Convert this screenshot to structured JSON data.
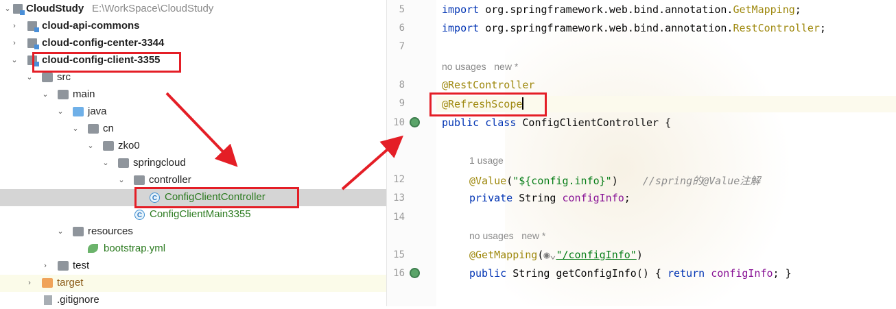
{
  "project": {
    "root_name": "CloudStudy",
    "root_path": "E:\\WorkSpace\\CloudStudy",
    "modules": [
      "cloud-api-commons",
      "cloud-config-center-3344",
      "cloud-config-client-3355"
    ],
    "tree": {
      "src": "src",
      "main": "main",
      "java": "java",
      "cn": "cn",
      "zko0": "zko0",
      "springcloud": "springcloud",
      "controller": "controller",
      "controller_class": "ConfigClientController",
      "main_class": "ConfigClientMain3355",
      "resources": "resources",
      "bootstrap": "bootstrap.yml",
      "test": "test",
      "target": "target",
      "gitignore": ".gitignore"
    }
  },
  "editor": {
    "line_numbers": [
      "5",
      "6",
      "7",
      "8",
      "9",
      "10",
      "12",
      "13",
      "14",
      "15",
      "16"
    ],
    "import1_kw": "import",
    "import1_pkg": " org.springframework.web.bind.annotation.",
    "import1_cls": "GetMapping",
    "import2_kw": "import",
    "import2_pkg": " org.springframework.web.bind.annotation.",
    "import2_cls": "RestController",
    "hint_no_usages_1": "no usages   new *",
    "ann_rest": "@RestController",
    "ann_refresh": "@RefreshScope",
    "class_kw": "public class",
    "class_name": " ConfigClientController {",
    "hint_1_usage": "1 usage",
    "value_ann": "@Value",
    "value_str": "\"${config.info}\"",
    "value_comment": "//spring的@Value注解",
    "field_kw": "private",
    "field_type": " String ",
    "field_name": "configInfo",
    "hint_no_usages_2": "no usages   new *",
    "getmapping_ann": "@GetMapping",
    "getmapping_str": "\"/configInfo\"",
    "method_kw": "public",
    "method_sig": " String getConfigInfo() { ",
    "return_kw": "return",
    "return_field": "configInfo",
    "method_end": "; }"
  },
  "colors": {
    "highlight_red": "#e41e26",
    "keyword": "#0033b3",
    "annotation": "#9e880d",
    "string": "#067d17",
    "field": "#871094"
  }
}
